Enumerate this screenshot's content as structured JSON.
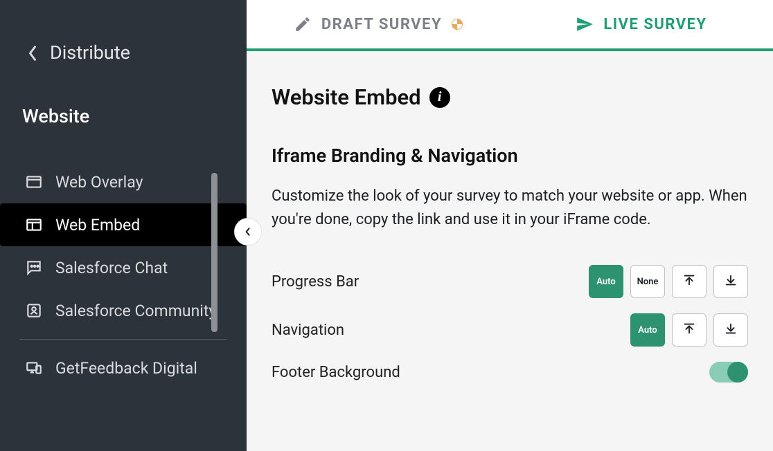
{
  "sidebar": {
    "back_label": "Distribute",
    "section_title": "Website",
    "items": [
      {
        "label": "Web Overlay"
      },
      {
        "label": "Web Embed"
      },
      {
        "label": "Salesforce Chat"
      },
      {
        "label": "Salesforce Community"
      },
      {
        "label": "GetFeedback Digital"
      }
    ]
  },
  "tabs": {
    "draft": "DRAFT SURVEY",
    "live": "LIVE SURVEY"
  },
  "page": {
    "title": "Website Embed",
    "info": "i",
    "section_heading": "Iframe Branding & Navigation",
    "section_desc": "Customize the look of your survey to match your website or app. When you're done, copy the link and use it in your iFrame code."
  },
  "options": {
    "progress_bar": {
      "label": "Progress Bar",
      "auto": "Auto",
      "none": "None"
    },
    "navigation": {
      "label": "Navigation",
      "auto": "Auto"
    },
    "footer_bg": {
      "label": "Footer Background"
    }
  }
}
